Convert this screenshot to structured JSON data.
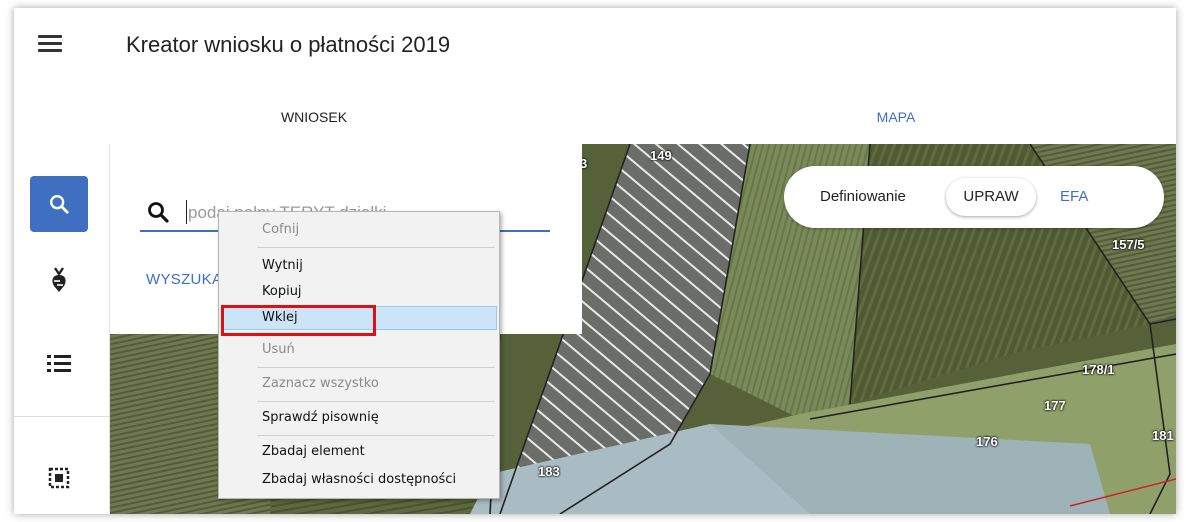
{
  "app": {
    "title": "Kreator wniosku o płatności 2019"
  },
  "tabs": [
    {
      "label": "WNIOSEK"
    },
    {
      "label": "MAPA"
    }
  ],
  "search": {
    "placeholder": "podaj pełny TERYT działki",
    "button_label": "WYSZUKAJ"
  },
  "toggle": {
    "label": "Definiowanie",
    "option_active": "UPRAW",
    "option_other": "EFA"
  },
  "context_menu": {
    "items": [
      {
        "label": "Cofnij",
        "enabled": false
      },
      {
        "label": "Wytnij",
        "enabled": true
      },
      {
        "label": "Kopiuj",
        "enabled": true
      },
      {
        "label": "Wklej",
        "enabled": true,
        "highlighted": true
      },
      {
        "label": "Usuń",
        "enabled": false
      },
      {
        "label": "Zaznacz wszystko",
        "enabled": false
      },
      {
        "label": "Sprawdź pisownię",
        "enabled": true
      },
      {
        "label": "Zbadaj element",
        "enabled": true
      },
      {
        "label": "Zbadaj własności dostępności",
        "enabled": true
      }
    ]
  },
  "map": {
    "parcel_labels": [
      "149",
      "3",
      "157/5",
      "178/1",
      "177",
      "176",
      "181",
      "183"
    ]
  },
  "colors": {
    "accent": "#3f6fc0",
    "highlight_border": "#e01010"
  },
  "icons": [
    "menu-icon",
    "search-icon",
    "crop-icon",
    "list-icon",
    "select-area-icon"
  ]
}
